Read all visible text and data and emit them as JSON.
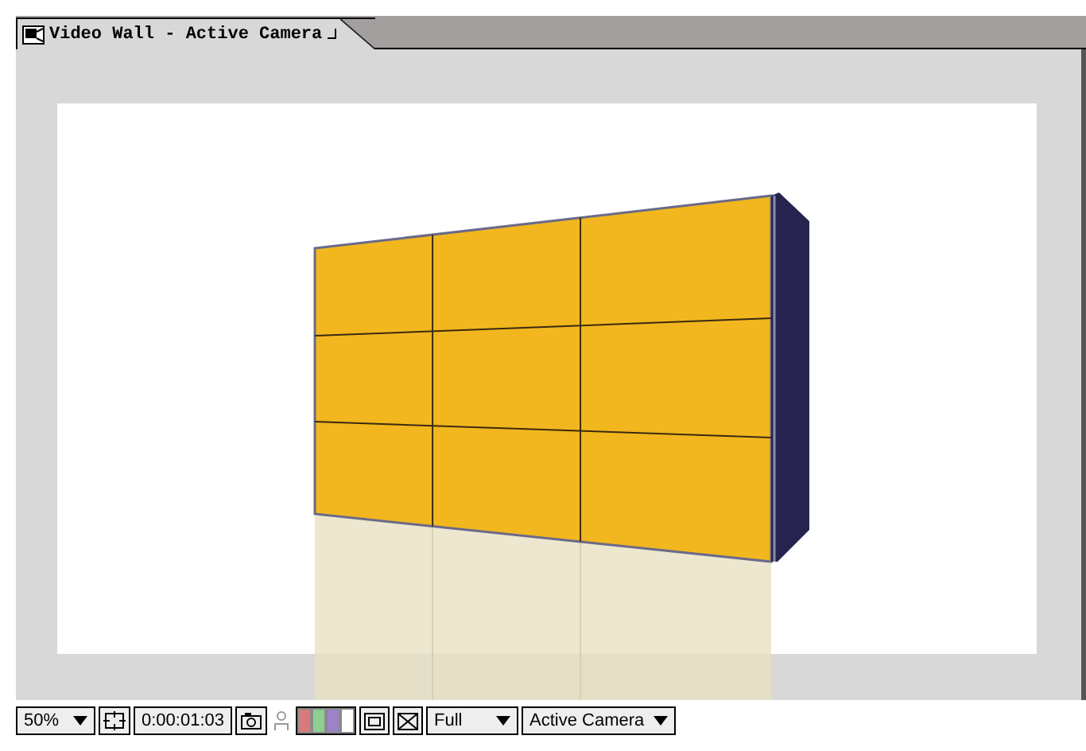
{
  "window": {
    "title": "Video Wall - Active Camera"
  },
  "toolbar": {
    "zoom": "50%",
    "timecode": "0:00:01:03",
    "resolution": "Full",
    "view": "Active Camera"
  },
  "channels": [
    {
      "color": "#d97a7a"
    },
    {
      "color": "#8fcf8f"
    },
    {
      "color": "#9c82c8"
    },
    {
      "color": "#ffffff"
    }
  ]
}
